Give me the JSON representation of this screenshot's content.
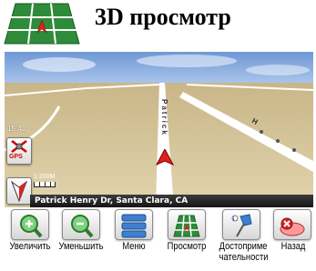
{
  "header": {
    "title": "3D просмотр",
    "icon": "3d-map-grid-icon"
  },
  "map": {
    "street_label": "Patrick",
    "side_street_label": "H",
    "time_readout": "15:41",
    "scale_readout": "1:200M",
    "address": "Patrick Henry Dr, Santa Clara, CA",
    "gps_label": "GPS",
    "colors": {
      "sky": "#7fa6dc",
      "ground": "#d8c8a0",
      "road": "#ffffff",
      "position": "#e02020"
    }
  },
  "toolbar": {
    "buttons": [
      {
        "label": "Увеличить",
        "icon": "zoom-in-icon"
      },
      {
        "label": "Уменьшить",
        "icon": "zoom-out-icon"
      },
      {
        "label": "Меню",
        "icon": "menu-icon"
      },
      {
        "label": "Просмотр",
        "icon": "map-view-icon"
      },
      {
        "label": "Достоприме чательности",
        "icon": "pushpin-icon"
      },
      {
        "label": "Назад",
        "icon": "back-icon"
      }
    ]
  }
}
